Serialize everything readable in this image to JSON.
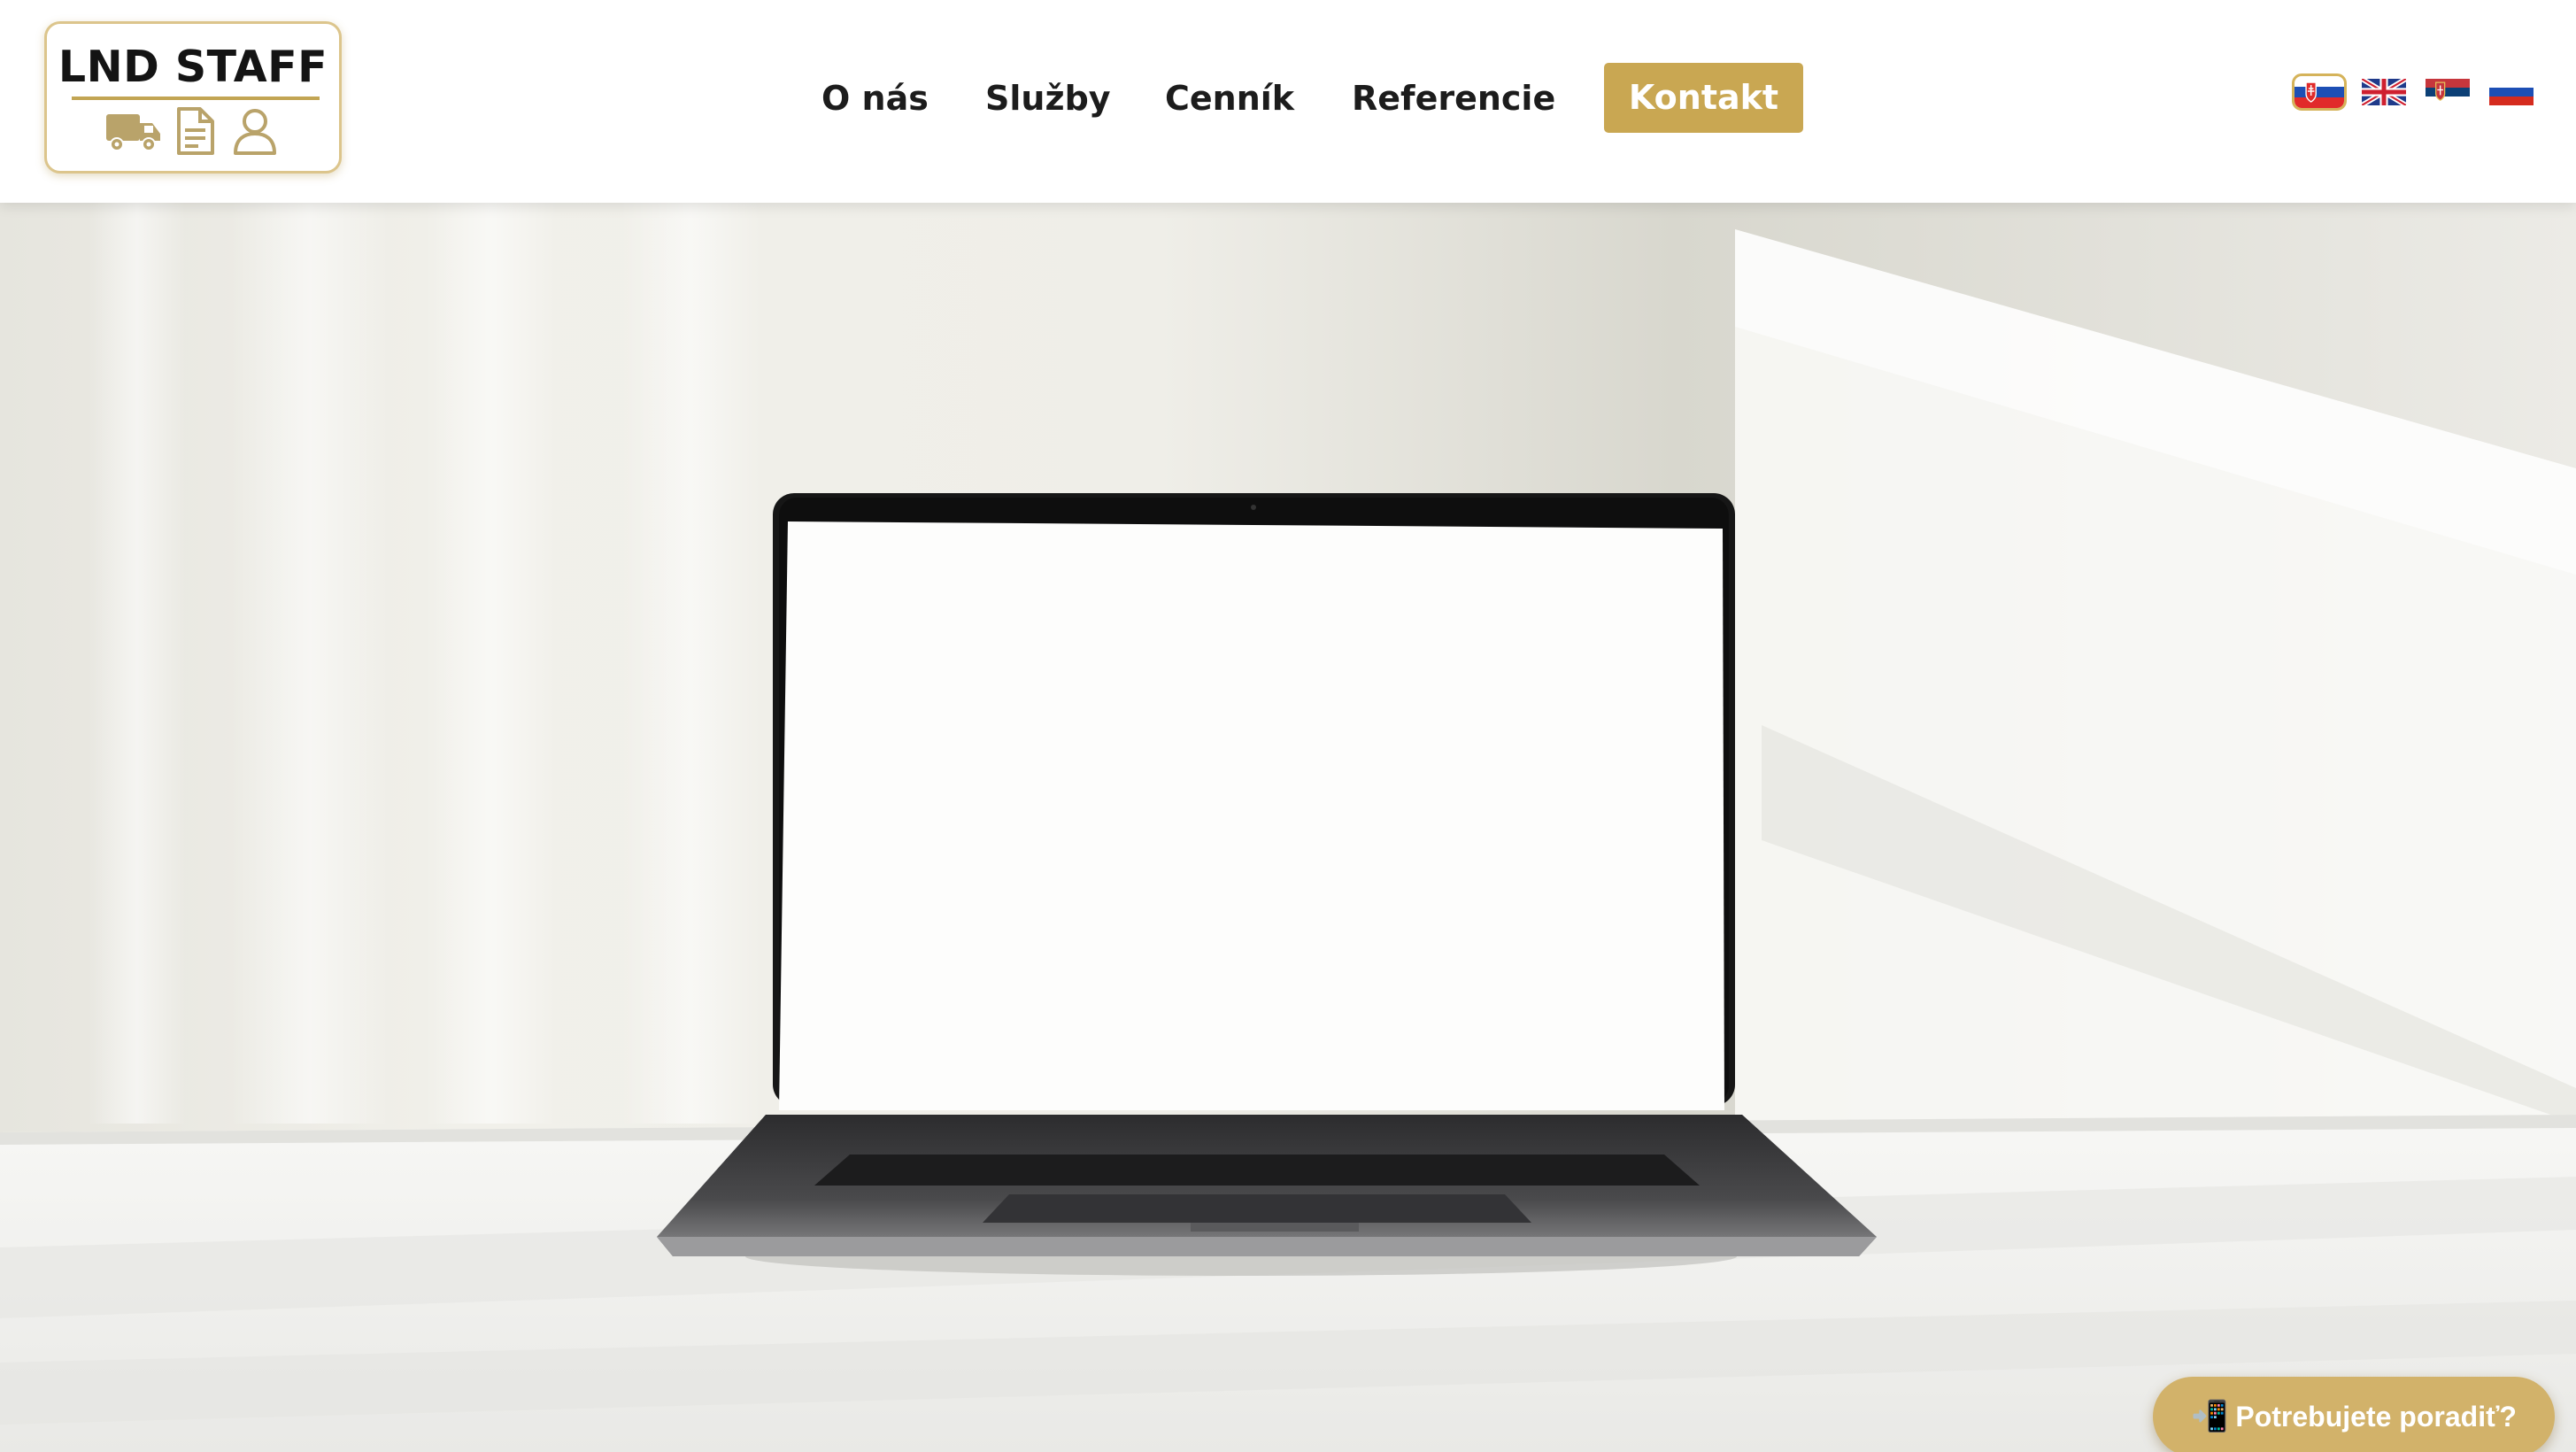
{
  "brand": {
    "name": "LND STAFF",
    "icons": [
      "truck-icon",
      "document-icon",
      "person-icon"
    ],
    "accent": "#c9a752"
  },
  "nav": {
    "items": [
      {
        "label": "O nás"
      },
      {
        "label": "Služby"
      },
      {
        "label": "Cenník"
      },
      {
        "label": "Referencie"
      }
    ],
    "cta": {
      "label": "Kontakt"
    }
  },
  "languages": [
    {
      "code": "sk",
      "icon": "slovakia-flag-icon",
      "active": true
    },
    {
      "code": "en",
      "icon": "uk-flag-icon",
      "active": false
    },
    {
      "code": "sr",
      "icon": "serbia-flag-icon",
      "active": false
    },
    {
      "code": "ru",
      "icon": "russia-flag-icon",
      "active": false
    }
  ],
  "hero": {
    "image": "laptop-on-desk-photo"
  },
  "chat": {
    "icon": "mobile-phone-icon",
    "phone_glyph": "📲",
    "label": "Potrebujete poradiť?"
  }
}
